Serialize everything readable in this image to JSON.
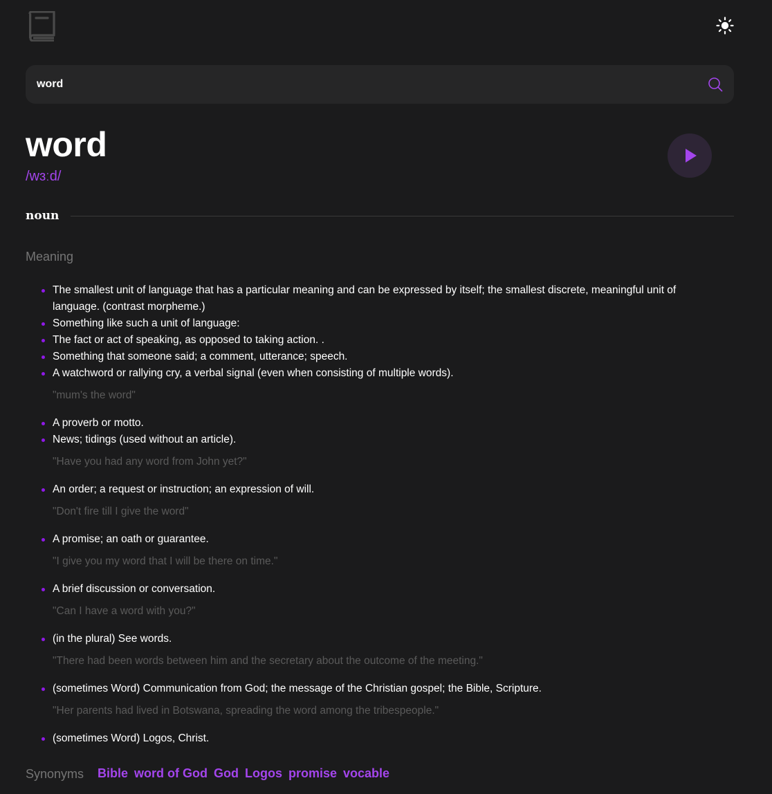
{
  "header": {
    "logo_icon": "book-icon",
    "theme_icon": "sun-icon"
  },
  "search": {
    "value": "word",
    "icon": "search-icon"
  },
  "entry": {
    "word": "word",
    "phonetic": "/wɜːd/",
    "play_icon": "play-icon",
    "part_of_speech": "noun",
    "meaning_label": "Meaning",
    "definitions": [
      {
        "text": "The smallest unit of language that has a particular meaning and can be expressed by itself; the smallest discrete, meaningful unit of language. (contrast morpheme.)"
      },
      {
        "text": "Something like such a unit of language:"
      },
      {
        "text": "The fact or act of speaking, as opposed to taking action. ."
      },
      {
        "text": "Something that someone said; a comment, utterance; speech."
      },
      {
        "text": "A watchword or rallying cry, a verbal signal (even when consisting of multiple words).",
        "example": "\"mum's the word\""
      },
      {
        "text": "A proverb or motto."
      },
      {
        "text": "News; tidings (used without an article).",
        "example": "\"Have you had any word from John yet?\""
      },
      {
        "text": "An order; a request or instruction; an expression of will.",
        "example": "\"Don't fire till I give the word\""
      },
      {
        "text": "A promise; an oath or guarantee.",
        "example": "\"I give you my word that I will be there on time.\""
      },
      {
        "text": "A brief discussion or conversation.",
        "example": "\"Can I have a word with you?\""
      },
      {
        "text": "(in the plural) See words.",
        "example": "\"There had been words between him and the secretary about the outcome of the meeting.\""
      },
      {
        "text": "(sometimes Word) Communication from God; the message of the Christian gospel; the Bible, Scripture.",
        "example": "\"Her parents had lived in Botswana, spreading the word among the tribespeople.\""
      },
      {
        "text": "(sometimes Word) Logos, Christ."
      }
    ],
    "synonyms_label": "Synonyms",
    "synonyms": [
      "Bible",
      "word of God",
      "God",
      "Logos",
      "promise",
      "vocable"
    ]
  },
  "colors": {
    "background": "#1b1b1c",
    "search_background": "#262627",
    "accent": "#a445ed",
    "bullet": "#8f19e8",
    "muted": "#757575",
    "example": "#5a5a5a"
  }
}
